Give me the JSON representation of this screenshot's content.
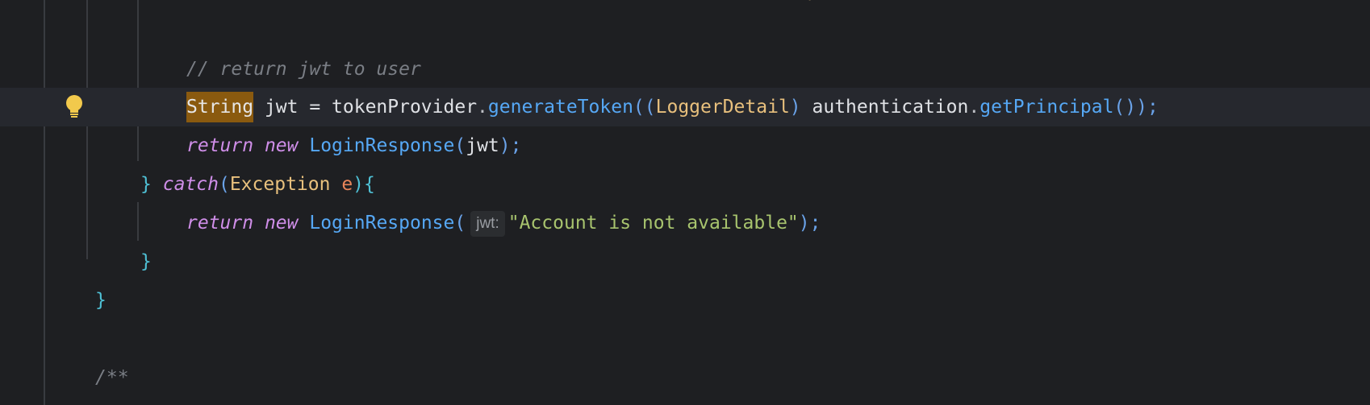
{
  "editor": {
    "lines": {
      "comment": "// return jwt to user",
      "assign": {
        "type": "String",
        "var": " jwt = ",
        "provider": "tokenProvider",
        "dot1": ".",
        "method": "generateToken",
        "open": "((",
        "cast": "LoggerDetail",
        "close_cast": ")",
        "space": " ",
        "auth": "authentication",
        "dot2": ".",
        "getter": "getPrincipal",
        "tail": "());"
      },
      "return1": {
        "kw_return": "return",
        "kw_new": "new",
        "cls": "LoginResponse",
        "open": "(",
        "arg": "jwt",
        "close": ");"
      },
      "catch": {
        "brace": "}",
        "kw": "catch",
        "open": "(",
        "type": "Exception",
        "param": "e",
        "close": "){"
      },
      "return2": {
        "kw_return": "return",
        "kw_new": "new",
        "cls": "LoginResponse",
        "open": "(",
        "inlay_hint": "jwt:",
        "str": "\"Account is not available\"",
        "close": ");"
      },
      "close_inner": "}",
      "close_outer": "}",
      "javadoc": "/**"
    },
    "icons": {
      "intention": "lightbulb-icon"
    },
    "colors": {
      "background": "#1e1f22",
      "current_line": "#26282e",
      "keyword": "#cf8ee8",
      "string": "#a8c46e",
      "method": "#56a8f5",
      "class": "#e8c07d",
      "comment": "#7a7e85",
      "highlight": "#8a5a0f",
      "bulb": "#f2c94c"
    }
  }
}
